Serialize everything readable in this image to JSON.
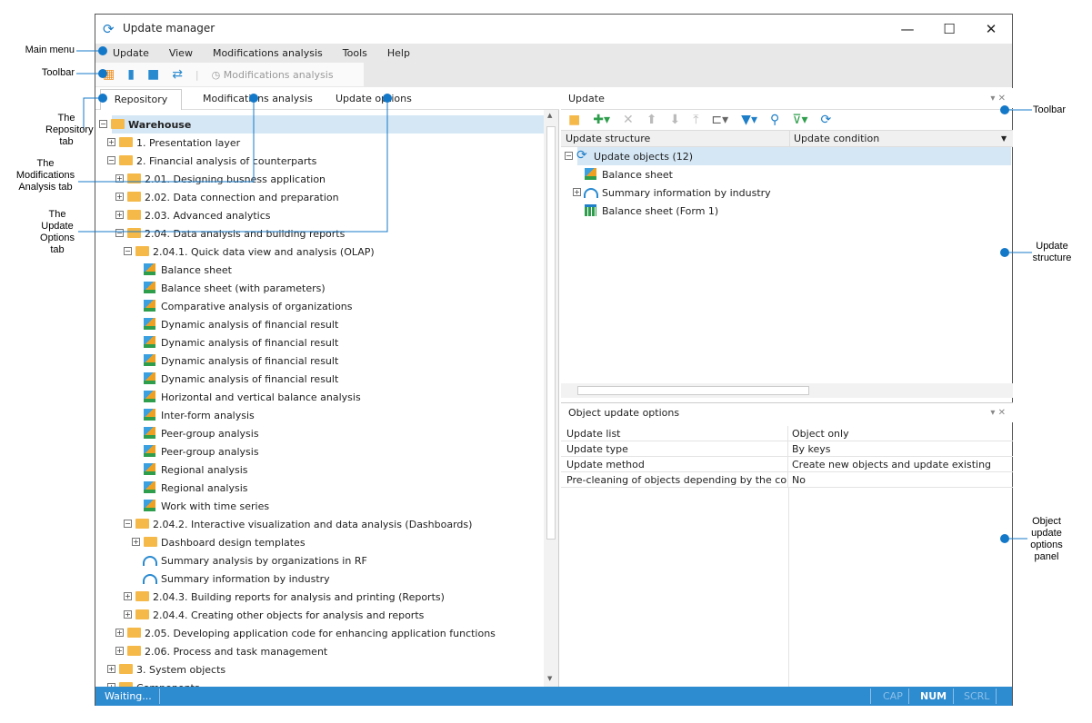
{
  "window": {
    "title": "Update manager",
    "min": "—",
    "max": "☐",
    "close": "✕"
  },
  "menu": [
    "Update",
    "View",
    "Modifications analysis",
    "Tools",
    "Help"
  ],
  "toolbar": {
    "mod_analysis": "Modifications analysis"
  },
  "tabs": [
    "Repository",
    "Modifications analysis",
    "Update options"
  ],
  "tree": [
    {
      "t": "Warehouse",
      "l": 0,
      "e": "−",
      "i": "folder",
      "sel": true
    },
    {
      "t": "1. Presentation layer",
      "l": 1,
      "e": "+",
      "i": "folder"
    },
    {
      "t": "2. Financial analysis of counterparts",
      "l": 1,
      "e": "−",
      "i": "folder"
    },
    {
      "t": "2.01. Designing busness application",
      "l": 2,
      "e": "+",
      "i": "folder"
    },
    {
      "t": "2.02. Data connection and preparation",
      "l": 2,
      "e": "+",
      "i": "folder"
    },
    {
      "t": "2.03. Advanced analytics",
      "l": 2,
      "e": "+",
      "i": "folder"
    },
    {
      "t": "2.04. Data analysis and building reports",
      "l": 2,
      "e": "−",
      "i": "folder"
    },
    {
      "t": "2.04.1. Quick data view and analysis (OLAP)",
      "l": 3,
      "e": "−",
      "i": "folder"
    },
    {
      "t": "Balance sheet",
      "l": 4,
      "i": "cube"
    },
    {
      "t": "Balance sheet (with parameters)",
      "l": 4,
      "i": "cube"
    },
    {
      "t": "Comparative analysis of organizations",
      "l": 4,
      "i": "cube"
    },
    {
      "t": "Dynamic analysis of financial result",
      "l": 4,
      "i": "cube"
    },
    {
      "t": "Dynamic analysis of financial result",
      "l": 4,
      "i": "cube"
    },
    {
      "t": "Dynamic analysis of financial result",
      "l": 4,
      "i": "cube"
    },
    {
      "t": "Dynamic analysis of financial result",
      "l": 4,
      "i": "cube"
    },
    {
      "t": "Horizontal and vertical balance analysis",
      "l": 4,
      "i": "cube"
    },
    {
      "t": "Inter-form analysis",
      "l": 4,
      "i": "cube"
    },
    {
      "t": "Peer-group analysis",
      "l": 4,
      "i": "cube"
    },
    {
      "t": "Peer-group analysis",
      "l": 4,
      "i": "cube"
    },
    {
      "t": "Regional analysis",
      "l": 4,
      "i": "cube"
    },
    {
      "t": "Regional analysis",
      "l": 4,
      "i": "cube"
    },
    {
      "t": "Work with time series",
      "l": 4,
      "i": "cube"
    },
    {
      "t": "2.04.2. Interactive visualization and data analysis (Dashboards)",
      "l": 3,
      "e": "−",
      "i": "folder"
    },
    {
      "t": "Dashboard design templates",
      "l": 4,
      "e": "+",
      "i": "folder"
    },
    {
      "t": "Summary analysis by organizations in RF",
      "l": 4,
      "i": "gauge"
    },
    {
      "t": "Summary information by industry",
      "l": 4,
      "i": "gauge"
    },
    {
      "t": "2.04.3. Building reports for analysis and printing (Reports)",
      "l": 3,
      "e": "+",
      "i": "folder"
    },
    {
      "t": "2.04.4. Creating other objects for analysis and reports",
      "l": 3,
      "e": "+",
      "i": "folder"
    },
    {
      "t": "2.05. Developing application code for enhancing application functions",
      "l": 2,
      "e": "+",
      "i": "folder"
    },
    {
      "t": "2.06. Process and task management",
      "l": 2,
      "e": "+",
      "i": "folder"
    },
    {
      "t": "3. System objects",
      "l": 1,
      "e": "+",
      "i": "folder"
    },
    {
      "t": "Components",
      "l": 1,
      "e": "+",
      "i": "folder"
    }
  ],
  "update_panel": {
    "title": "Update",
    "columns": [
      "Update structure",
      "Update condition"
    ],
    "items": [
      {
        "t": "Update objects (12)",
        "l": 0,
        "e": "−",
        "i": "update",
        "sel": true
      },
      {
        "t": "Balance sheet",
        "l": 1,
        "i": "cube"
      },
      {
        "t": "Summary information by industry",
        "l": 1,
        "e": "+",
        "i": "gauge"
      },
      {
        "t": "Balance sheet (Form 1)",
        "l": 1,
        "i": "grid"
      }
    ]
  },
  "options_panel": {
    "title": "Object update options",
    "rows": [
      [
        "Update list",
        "Object only"
      ],
      [
        "Update type",
        "By keys"
      ],
      [
        "Update method",
        "Create new objects and update existing"
      ],
      [
        "Pre-cleaning of objects depending by the contents",
        "No"
      ]
    ]
  },
  "status": {
    "text": "Waiting...",
    "cap": "CAP",
    "num": "NUM",
    "scrl": "SCRL"
  },
  "annotations": {
    "main_menu": "Main menu",
    "toolbar": "Toolbar",
    "repo_tab": "The Repository tab",
    "mod_tab": "The Modifications Analysis tab",
    "upd_tab": "The Update Options tab",
    "right_toolbar": "Toolbar",
    "update_structure": "Update structure",
    "options_panel": "Object update options panel"
  }
}
